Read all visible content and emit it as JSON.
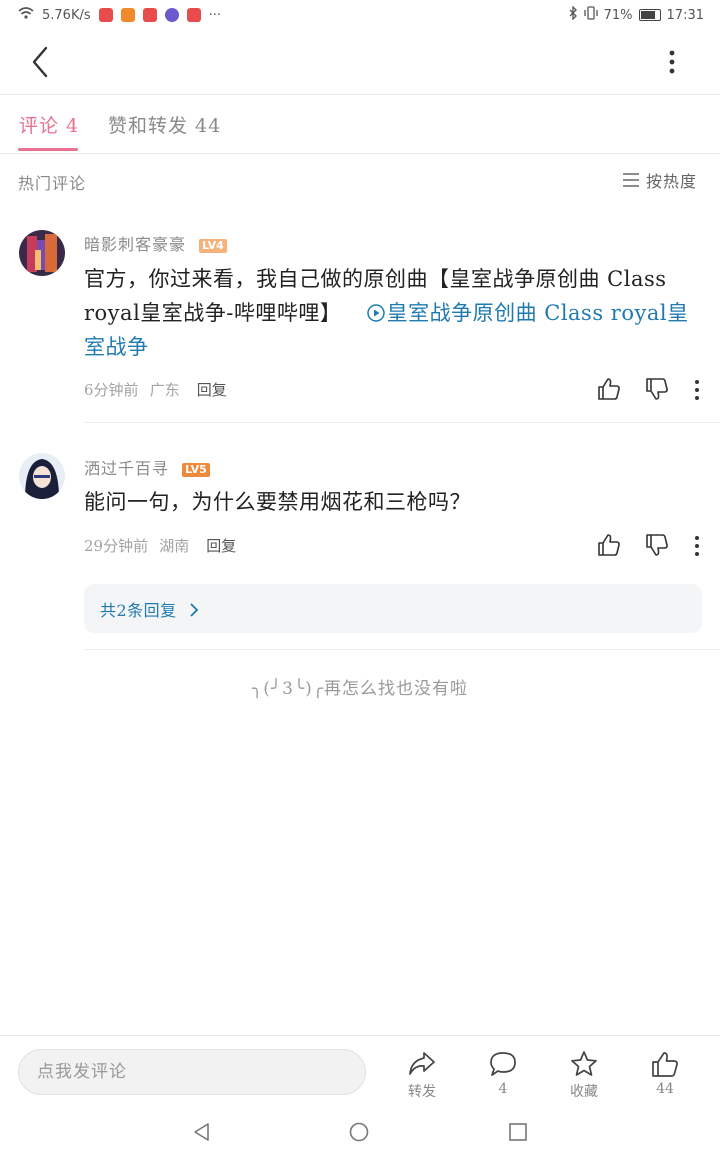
{
  "status_bar": {
    "speed": "5.76K/s",
    "battery": "71%",
    "time": "17:31",
    "more": "···"
  },
  "tabs": [
    {
      "label": "评论 4",
      "active": true
    },
    {
      "label": "赞和转发 44",
      "active": false
    }
  ],
  "section": {
    "title": "热门评论",
    "sort_label": "按热度"
  },
  "comments": [
    {
      "username": "暗影刺客豪豪",
      "level": "LV4",
      "level_color": "#f5b27a",
      "text": "官方，你过来看，我自己做的原创曲【皇室战争原创曲 Class royal皇室战争-哔哩哔哩】",
      "link_text": "皇室战争原创曲 Class royal皇室战争",
      "time": "6分钟前",
      "location": "广东",
      "reply_label": "回复"
    },
    {
      "username": "洒过千百寻",
      "level": "LV5",
      "level_color": "#ef8a3c",
      "text": "能问一句，为什么要禁用烟花和三枪吗？",
      "time": "29分钟前",
      "location": "湖南",
      "reply_label": "回复",
      "replies_label": "共2条回复"
    }
  ],
  "empty_text": "╮(╯3╰)╭再怎么找也没有啦",
  "bottom": {
    "input_placeholder": "点我发评论",
    "actions": [
      {
        "icon": "share-icon",
        "label": "转发"
      },
      {
        "icon": "comment-icon",
        "label": "4"
      },
      {
        "icon": "star-icon",
        "label": "收藏"
      },
      {
        "icon": "thumb-up-icon",
        "label": "44"
      }
    ]
  },
  "colors": {
    "accent": "#e8718f",
    "link": "#1f7ab0"
  }
}
